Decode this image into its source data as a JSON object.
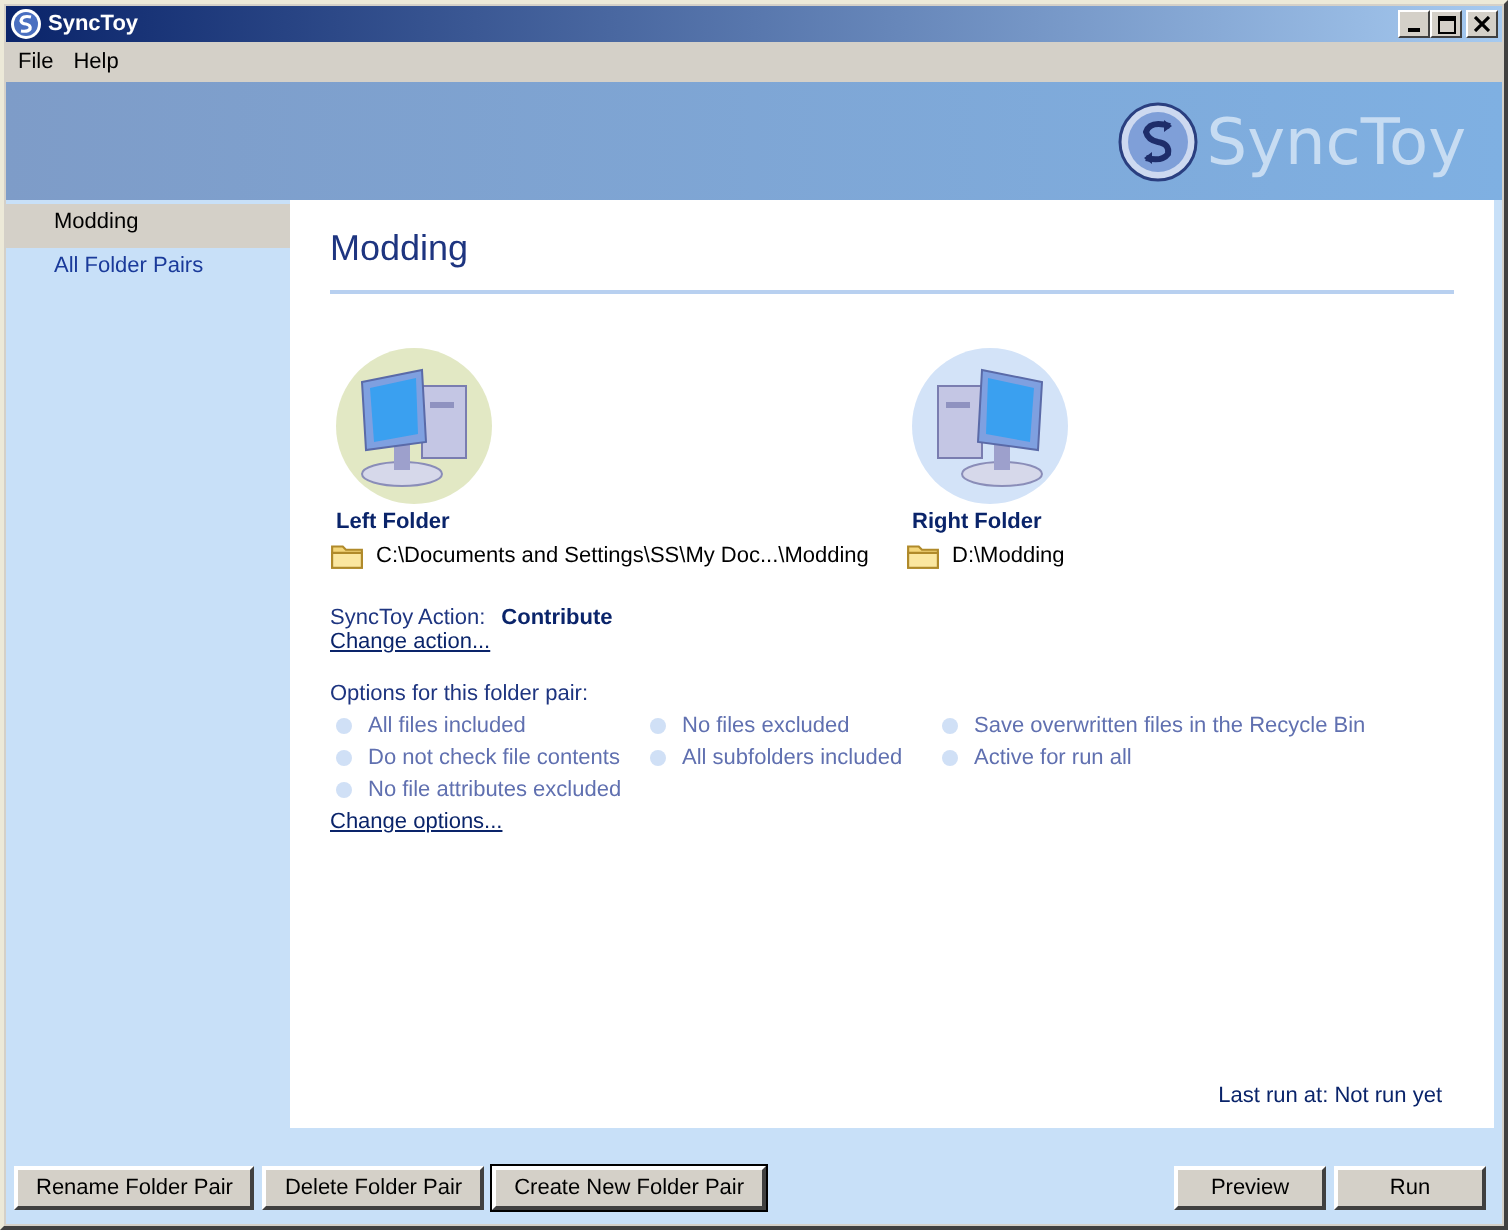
{
  "window": {
    "title": "SyncToy"
  },
  "menu": [
    "File",
    "Help"
  ],
  "banner": {
    "logo_text": "SyncToy"
  },
  "sidebar": {
    "items": [
      {
        "label": "Modding",
        "selected": true
      },
      {
        "label": "All Folder Pairs",
        "selected": false
      }
    ]
  },
  "pair": {
    "title": "Modding",
    "folders": [
      {
        "kind": "left",
        "label": "Left Folder",
        "path": "C:\\Documents and Settings\\SS\\My Doc...\\Modding"
      },
      {
        "kind": "right",
        "label": "Right Folder",
        "path": "D:\\Modding"
      }
    ],
    "action_label": "SyncToy Action:",
    "action_value": "Contribute",
    "change_action": "Change action...",
    "options_heading": "Options for this folder pair:",
    "options": [
      "All files included",
      "No files excluded",
      "Save overwritten files in the Recycle Bin",
      "Do not check file contents",
      "All subfolders included",
      "Active for run all",
      "No file attributes excluded"
    ],
    "change_options": "Change options...",
    "last_run": "Last run at: Not run yet"
  },
  "buttons_left": [
    {
      "label": "Rename Folder Pair",
      "default": false
    },
    {
      "label": "Delete Folder Pair",
      "default": false
    },
    {
      "label": "Create New Folder Pair",
      "default": true
    }
  ],
  "buttons_right": [
    {
      "label": "Preview",
      "default": false
    },
    {
      "label": "Run",
      "default": false
    }
  ]
}
